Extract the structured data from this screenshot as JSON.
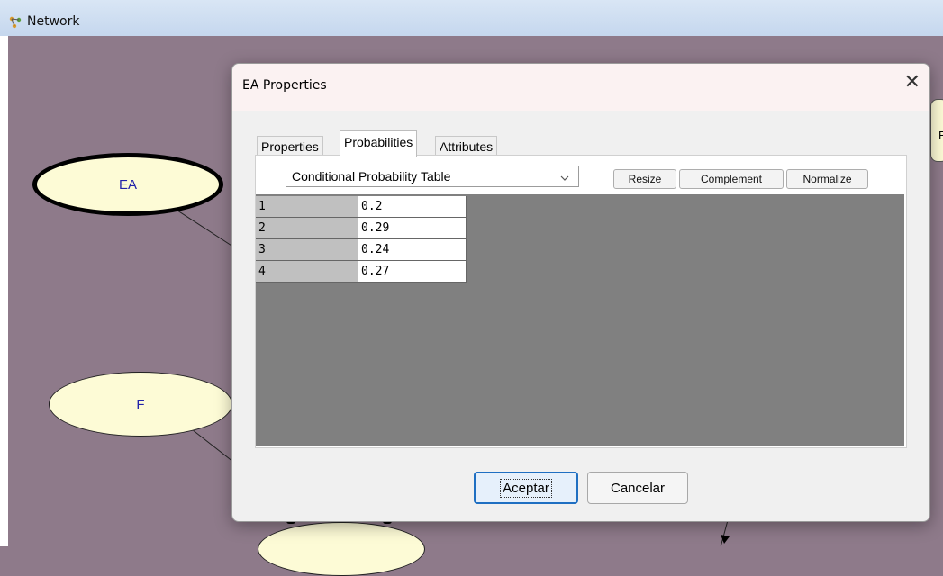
{
  "window": {
    "title": "Network",
    "icon": "network-icon"
  },
  "nodes": [
    {
      "id": "ea",
      "label": "EA",
      "selected": true
    },
    {
      "id": "f",
      "label": "F",
      "selected": false
    },
    {
      "id": "bottom",
      "label": "",
      "selected": false
    },
    {
      "id": "right",
      "label": "E",
      "selected": false
    }
  ],
  "dialog": {
    "title": "EA Properties",
    "close_icon": "close-icon",
    "tabs": [
      {
        "label": "Properties",
        "active": false
      },
      {
        "label": "Probabilities",
        "active": true
      },
      {
        "label": "Attributes",
        "active": false
      }
    ],
    "table_type": {
      "selected": "Conditional Probability Table"
    },
    "buttons": {
      "resize": "Resize",
      "complement": "Complement",
      "normalize": "Normalize"
    },
    "table_rows": [
      {
        "index": "1",
        "value": "0.2"
      },
      {
        "index": "2",
        "value": "0.29"
      },
      {
        "index": "3",
        "value": "0.24"
      },
      {
        "index": "4",
        "value": "0.27"
      }
    ],
    "ok_label": "Aceptar",
    "cancel_label": "Cancelar"
  },
  "colors": {
    "canvas": "#8e7a8a",
    "node_fill": "#fdfbd6",
    "node_text": "#2222aa",
    "grid_bg": "#808080"
  }
}
